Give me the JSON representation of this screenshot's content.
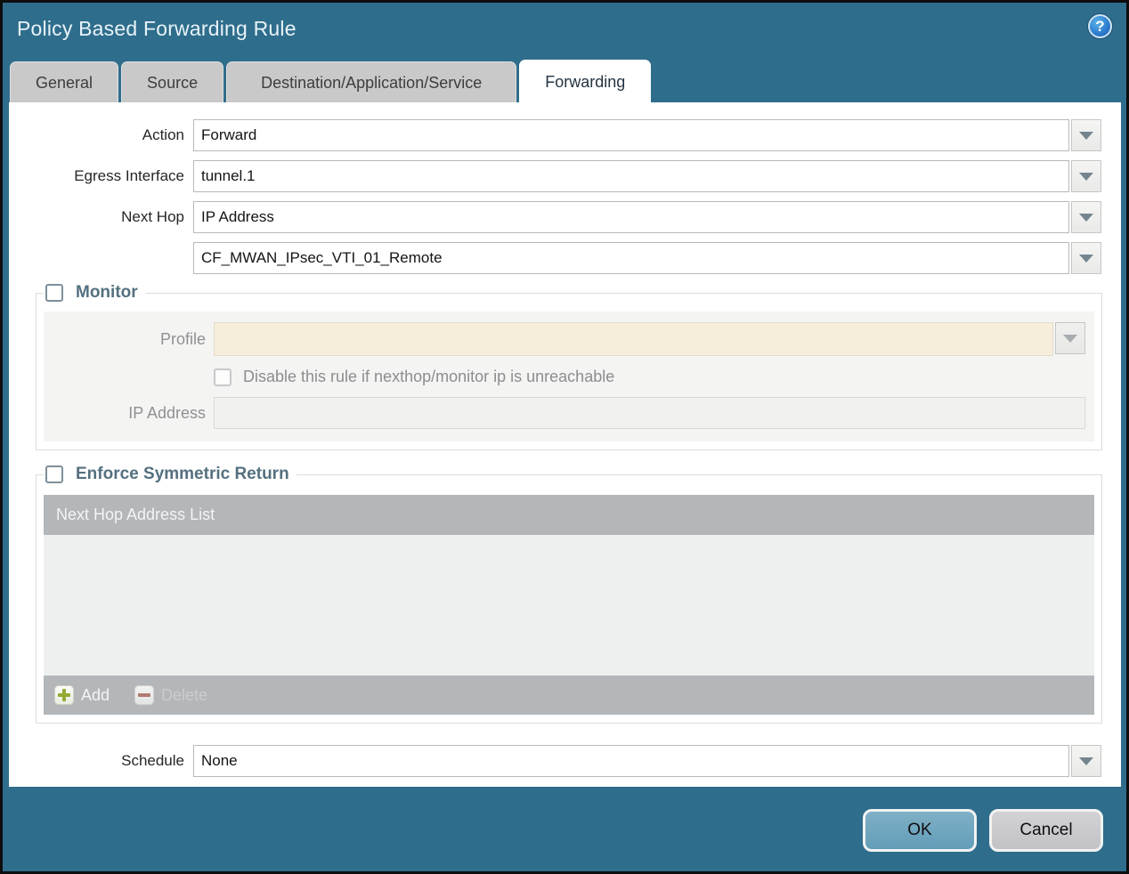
{
  "dialog": {
    "title": "Policy Based Forwarding Rule"
  },
  "icons": {
    "help_glyph": "?"
  },
  "tabs": [
    {
      "label": "General",
      "active": false
    },
    {
      "label": "Source",
      "active": false
    },
    {
      "label": "Destination/Application/Service",
      "active": false
    },
    {
      "label": "Forwarding",
      "active": true
    }
  ],
  "form": {
    "action": {
      "label": "Action",
      "value": "Forward"
    },
    "egress_interface": {
      "label": "Egress Interface",
      "value": "tunnel.1"
    },
    "next_hop": {
      "label": "Next Hop",
      "value": "IP Address"
    },
    "next_hop_address": {
      "value": "CF_MWAN_IPsec_VTI_01_Remote"
    },
    "monitor": {
      "label": "Monitor",
      "checked": false,
      "profile": {
        "label": "Profile",
        "value": ""
      },
      "disable_rule": {
        "label": "Disable this rule if nexthop/monitor ip is unreachable",
        "checked": false
      },
      "ip_address": {
        "label": "IP Address",
        "value": ""
      }
    },
    "enforce_symmetric_return": {
      "label": "Enforce Symmetric Return",
      "checked": false,
      "table": {
        "header": "Next Hop Address List",
        "rows": [],
        "add_label": "Add",
        "delete_label": "Delete",
        "delete_enabled": false
      }
    },
    "schedule": {
      "label": "Schedule",
      "value": "None"
    }
  },
  "footer": {
    "ok_label": "OK",
    "cancel_label": "Cancel"
  },
  "colors": {
    "frame_teal": "#2f6d8c",
    "active_tab_bg": "#ffffff",
    "inactive_tab_bg": "#c9c9c9",
    "legend_text": "#54707f",
    "disabled_input_bg": "#f6eedb",
    "table_bar_bg": "#b3b7ba",
    "table_body_bg": "#eef0ef",
    "add_plus_green": "#93ab34",
    "delete_minus_red": "#b27a70",
    "ok_button_bg": "#6fa6bf",
    "cancel_button_bg": "#c9c9cd"
  }
}
